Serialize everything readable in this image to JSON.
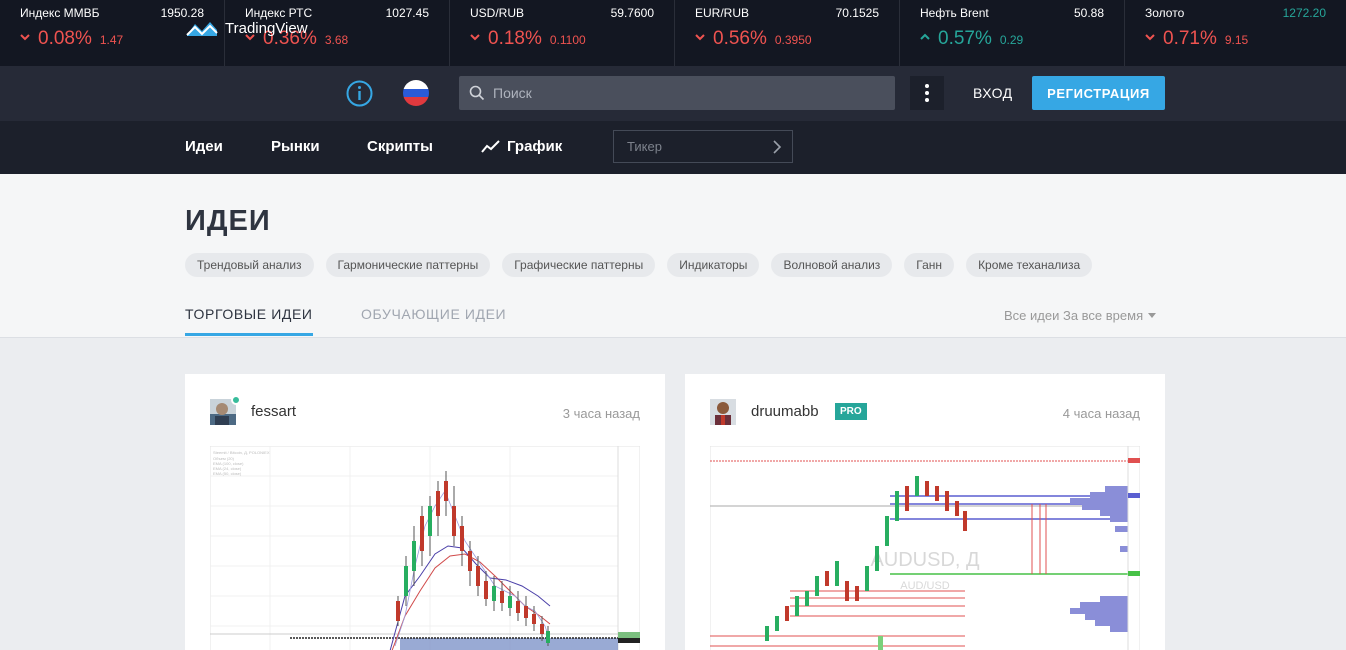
{
  "tickers": [
    {
      "name": "Индекс ММВБ",
      "price": "1950.28",
      "pct": "0.08%",
      "chg": "1.47",
      "dir": "down"
    },
    {
      "name": "Индекс РТС",
      "price": "1027.45",
      "pct": "0.36%",
      "chg": "3.68",
      "dir": "down"
    },
    {
      "name": "USD/RUB",
      "price": "59.7600",
      "pct": "0.18%",
      "chg": "0.1100",
      "dir": "down"
    },
    {
      "name": "EUR/RUB",
      "price": "70.1525",
      "pct": "0.56%",
      "chg": "0.3950",
      "dir": "down"
    },
    {
      "name": "Нефть Brent",
      "price": "50.88",
      "pct": "0.57%",
      "chg": "0.29",
      "dir": "up"
    },
    {
      "name": "Золото",
      "price": "1272.20",
      "pct": "0.71%",
      "chg": "9.15",
      "dir": "down"
    }
  ],
  "header": {
    "logo_text": "TradingView",
    "search_placeholder": "Поиск",
    "login_label": "ВХОД",
    "register_label": "РЕГИСТРАЦИЯ"
  },
  "nav": {
    "items": [
      "Идеи",
      "Рынки",
      "Скрипты",
      "График"
    ],
    "ticker_placeholder": "Тикер"
  },
  "ideas": {
    "title": "ИДЕИ",
    "chips": [
      "Трендовый анализ",
      "Гармонические паттерны",
      "Графические паттерны",
      "Индикаторы",
      "Волновой анализ",
      "Ганн",
      "Кроме теханализа"
    ],
    "tab_trading": "ТОРГОВЫЕ ИДЕИ",
    "tab_learning": "ОБУЧАЮЩИЕ ИДЕИ",
    "filter": "Все идеи За все время"
  },
  "cards": [
    {
      "author": "fessart",
      "time": "3 часа назад"
    },
    {
      "author": "druumabb",
      "time": "4 часа назад",
      "badge": "PRO",
      "chart_watermark": "AUDUSD, Д",
      "chart_watermark_sub": "AUD/USD"
    }
  ],
  "colors": {
    "down": "#ef5350",
    "up": "#26a69a",
    "accent": "#36a7e4"
  }
}
